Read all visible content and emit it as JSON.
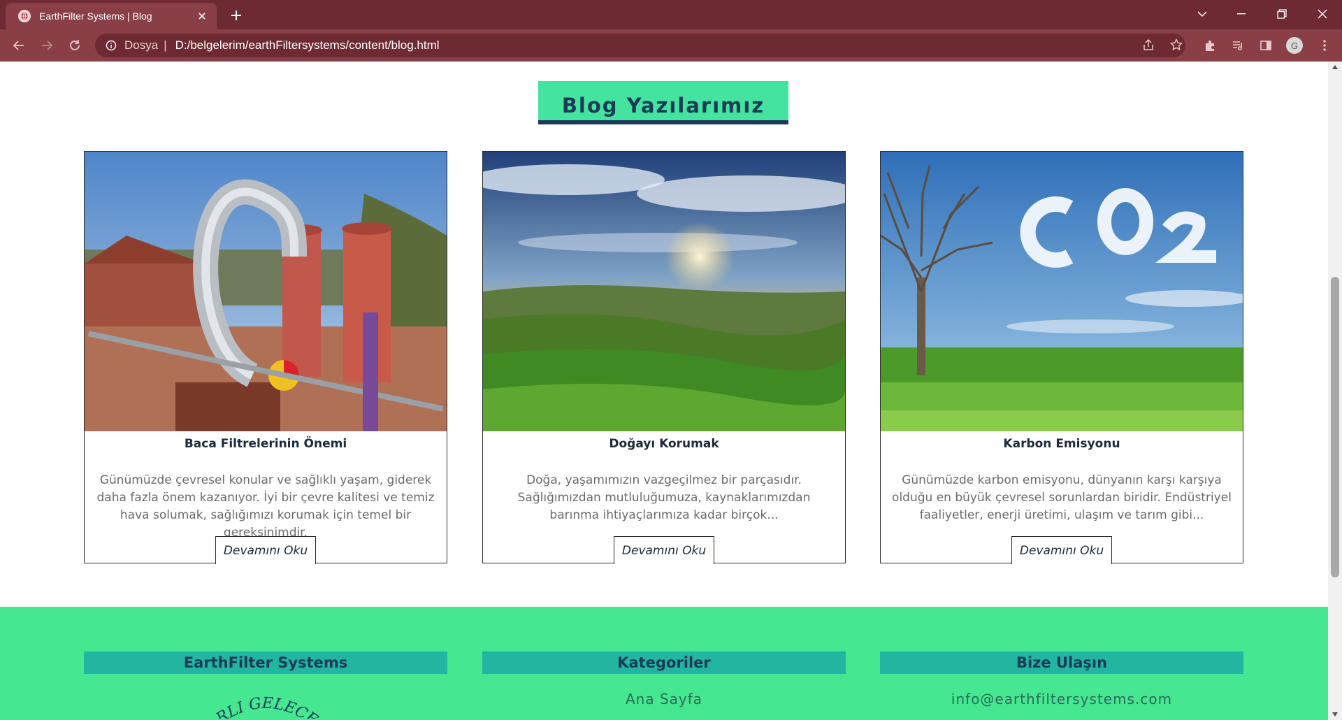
{
  "browser": {
    "tab_title": "EarthFilter Systems | Blog",
    "scheme_label": "Dosya",
    "url": "D:/belgelerim/earthFiltersystems/content/blog.html",
    "profile_initial": "G"
  },
  "blog": {
    "heading": "Blog Yazılarımız",
    "posts": [
      {
        "title": "Baca Filtrelerinin Önemi",
        "excerpt": "Günümüzde çevresel konular ve sağlıklı yaşam, giderek daha fazla önem kazanıyor. İyi bir çevre kalitesi ve temiz hava solumak, sağlığımızı korumak için temel bir gereksinimdir.",
        "button": "Devamını Oku"
      },
      {
        "title": "Doğayı Korumak",
        "excerpt": "Doğa, yaşamımızın vazgeçilmez bir parçasıdır. Sağlığımızdan mutluluğumuza, kaynaklarımızdan barınma ihtiyaçlarımıza kadar birçok...",
        "button": "Devamını Oku"
      },
      {
        "title": "Karbon Emisyonu",
        "excerpt": "Günümüzde karbon emisyonu, dünyanın karşı karşıya olduğu en büyük çevresel sorunlardan biridir. Endüstriyel faaliyetler, enerji üretimi, ulaşım ve tarım gibi...",
        "button": "Devamını Oku"
      }
    ]
  },
  "footer": {
    "col1_heading": "EarthFilter Systems",
    "logo_text": "...RLI GELECEK",
    "col2_heading": "Kategoriler",
    "col2_link": "Ana Sayfa",
    "col3_heading": "Bize Ulaşın",
    "col3_email": "info@earthfiltersystems.com"
  },
  "colors": {
    "tab_bar": "#6e2a33",
    "toolbar": "#8a3f47",
    "heading_bg": "#45e3a0",
    "heading_text": "#1b3a57",
    "footer_bg": "#45e890",
    "footer_heading_bg": "#22b5a0"
  }
}
